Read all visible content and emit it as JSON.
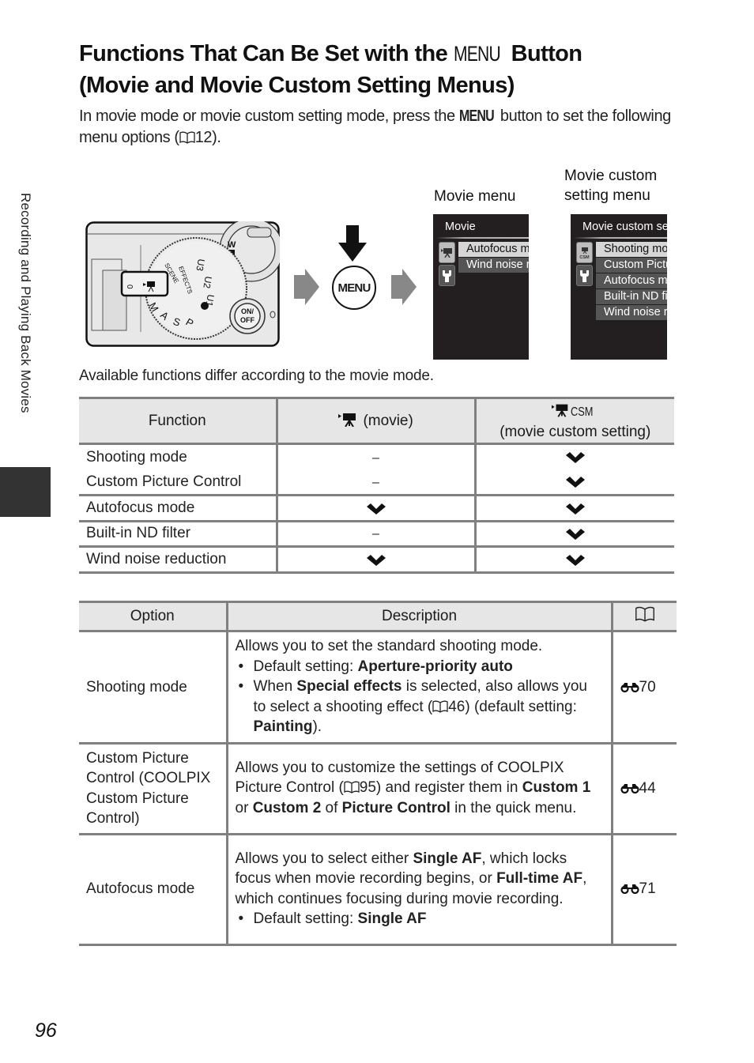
{
  "title": {
    "line1_before": "Functions That Can Be Set with the ",
    "line1_menu": "MENU",
    "line1_after": " Button",
    "line2": "(Movie and Movie Custom Setting Menus)"
  },
  "intro": {
    "part1": "In movie mode or movie custom setting mode, press the ",
    "menu": "MENU",
    "part2": " button to set the following menu options (",
    "page_ref": "12",
    "part3": ")."
  },
  "side_tab": {
    "label": "Recording and Playing Back Movies"
  },
  "figure": {
    "menu_button_label": "MENU",
    "camera": {
      "on_off_label": "ON/\nOFF",
      "zoom_label": "W",
      "dial_labels": [
        "EFFECTS",
        "SCENE",
        "U3",
        "U2",
        "U1",
        "P",
        "S",
        "A",
        "M"
      ]
    },
    "movie_menu": {
      "label": "Movie menu",
      "screen_title": "Movie",
      "items": [
        "Autofocus mode",
        "Wind noise reduction"
      ]
    },
    "movie_custom_menu": {
      "label_line1": "Movie custom",
      "label_line2": "setting menu",
      "screen_title": "Movie custom setting",
      "items": [
        "Shooting mode",
        "Custom Picture Control",
        "Autofocus mode",
        "Built-in ND filter",
        "Wind noise reduction"
      ]
    }
  },
  "caption": "Available functions differ according to the movie mode.",
  "functions_table": {
    "headers": {
      "function": "Function",
      "movie": "(movie)",
      "custom_top": "CSM",
      "custom": "(movie custom setting)"
    },
    "rows": [
      {
        "function": "Shooting mode",
        "movie": "–",
        "custom": "check"
      },
      {
        "function": "Custom Picture Control",
        "movie": "–",
        "custom": "check"
      },
      {
        "function": "Autofocus mode",
        "movie": "check",
        "custom": "check"
      },
      {
        "function": "Built-in ND filter",
        "movie": "–",
        "custom": "check"
      },
      {
        "function": "Wind noise reduction",
        "movie": "check",
        "custom": "check"
      }
    ]
  },
  "options_table": {
    "headers": {
      "option": "Option",
      "description": "Description",
      "ref": "book-icon"
    },
    "rows": [
      {
        "option": "Shooting mode",
        "desc_intro": "Allows you to set the standard shooting mode.",
        "b1_pre": "Default setting: ",
        "b1_bold": "Aperture-priority auto",
        "b2_pre": "When ",
        "b2_bold1": "Special effects",
        "b2_mid": " is selected, also allows you to select a shooting effect (",
        "b2_ref": "46",
        "b2_mid2": ") (default setting: ",
        "b2_bold2": "Painting",
        "b2_end": ").",
        "ref": "70"
      },
      {
        "option": "Custom Picture Control (COOLPIX Custom Picture Control)",
        "d1": "Allows you to customize the settings of COOLPIX Picture Control (",
        "d_ref": "95",
        "d2": ") and register them in ",
        "bold1": "Custom 1",
        "d3": " or ",
        "bold2": "Custom 2",
        "d4": " of ",
        "bold3": "Picture Control",
        "d5": " in the quick menu.",
        "ref": "44"
      },
      {
        "option": "Autofocus mode",
        "d1": "Allows you to select either ",
        "bold1": "Single AF",
        "d2": ", which locks focus when movie recording begins, or ",
        "bold2": "Full-time AF",
        "d3": ", which continues focusing during movie recording.",
        "b1_pre": "Default setting: ",
        "b1_bold": "Single AF",
        "ref": "71"
      }
    ]
  },
  "page_number": "96"
}
